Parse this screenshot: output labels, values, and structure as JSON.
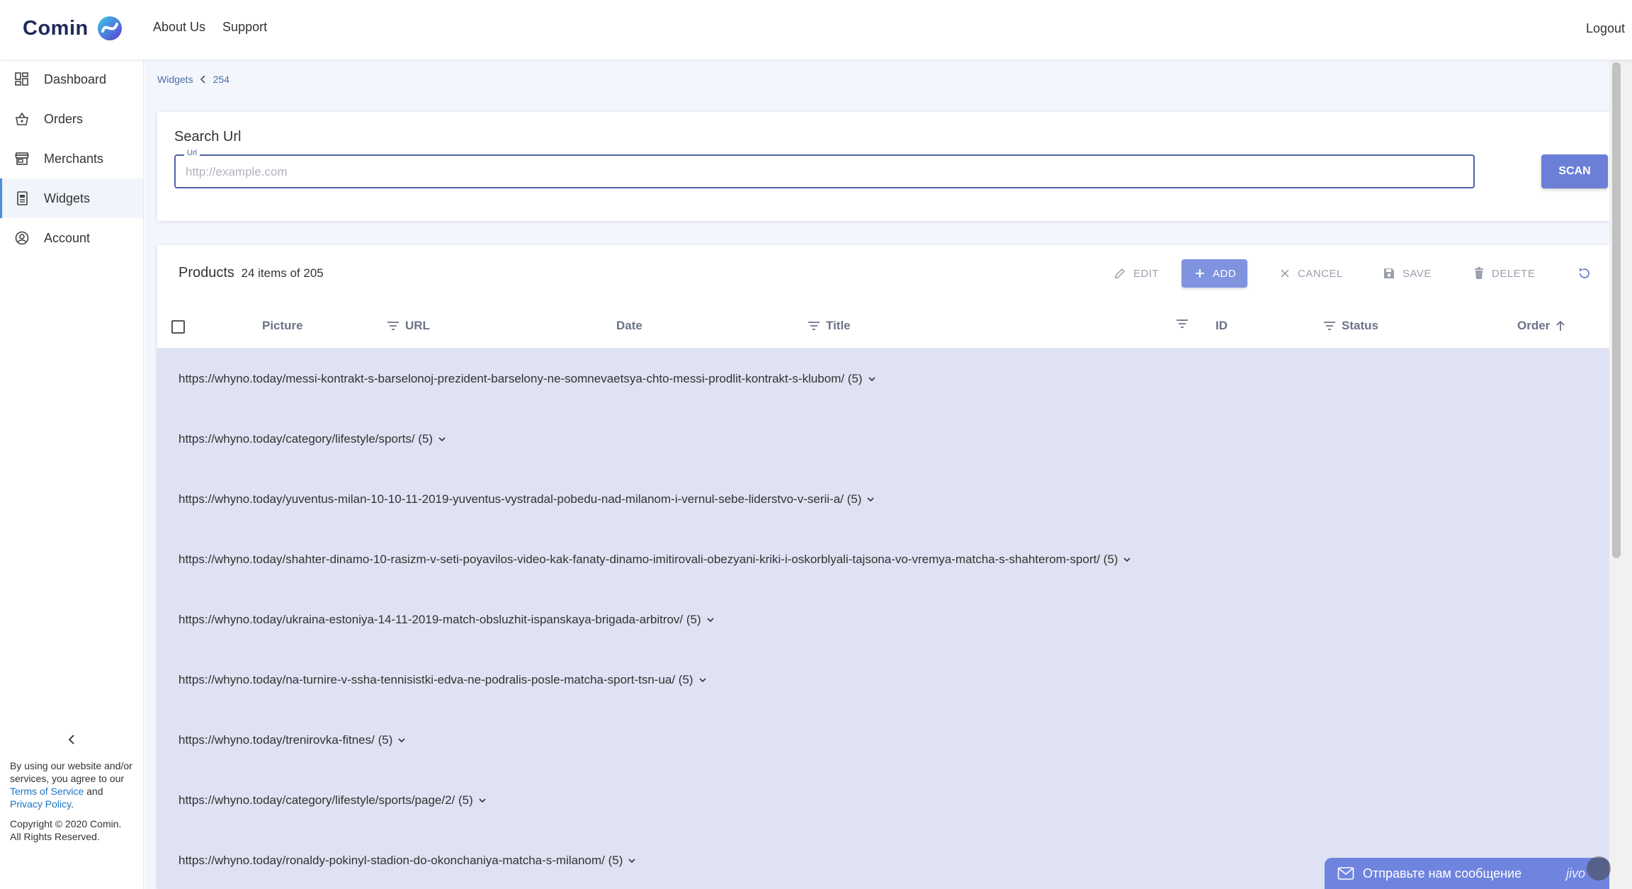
{
  "brand": {
    "name": "Comin"
  },
  "topnav": {
    "about": "About Us",
    "support": "Support",
    "logout": "Logout"
  },
  "sidebar": {
    "items": [
      {
        "label": "Dashboard",
        "icon": "dashboard-icon"
      },
      {
        "label": "Orders",
        "icon": "basket-icon"
      },
      {
        "label": "Merchants",
        "icon": "store-icon"
      },
      {
        "label": "Widgets",
        "icon": "widget-doc-icon",
        "active": true
      },
      {
        "label": "Account",
        "icon": "account-circle-icon"
      }
    ],
    "legal": {
      "intro": "By using our website and/or services, you agree to our ",
      "terms": "Terms of Service",
      "and": " and ",
      "privacy": "Privacy Policy",
      "period": ".",
      "copyright": "Copyright © 2020 Comin. All Rights Reserved."
    }
  },
  "breadcrumb": {
    "root": "Widgets",
    "current": "254"
  },
  "search": {
    "title": "Search Url",
    "field_label": "Url",
    "placeholder": "http://example.com",
    "value": "",
    "scan_label": "SCAN"
  },
  "products": {
    "title": "Products",
    "count_text": "24 items of 205",
    "toolbar": {
      "edit": "EDIT",
      "add": "ADD",
      "cancel": "CANCEL",
      "save": "SAVE",
      "delete": "DELETE"
    },
    "columns": {
      "picture": "Picture",
      "url": "URL",
      "date": "Date",
      "title": "Title",
      "id": "ID",
      "status": "Status",
      "order": "Order"
    },
    "groups": [
      "https://whyno.today/messi-kontrakt-s-barselonoj-prezident-barselony-ne-somnevaetsya-chto-messi-prodlit-kontrakt-s-klubom/ (5)",
      "https://whyno.today/category/lifestyle/sports/ (5)",
      "https://whyno.today/yuventus-milan-10-10-11-2019-yuventus-vystradal-pobedu-nad-milanom-i-vernul-sebe-liderstvo-v-serii-a/ (5)",
      "https://whyno.today/shahter-dinamo-10-rasizm-v-seti-poyavilos-video-kak-fanaty-dinamo-imitirovali-obezyani-kriki-i-oskorblyali-tajsona-vo-vremya-matcha-s-shahterom-sport/ (5)",
      "https://whyno.today/ukraina-estoniya-14-11-2019-match-obsluzhit-ispanskaya-brigada-arbitrov/ (5)",
      "https://whyno.today/na-turnire-v-ssha-tennisistki-edva-ne-podralis-posle-matcha-sport-tsn-ua/ (5)",
      "https://whyno.today/trenirovka-fitnes/ (5)",
      "https://whyno.today/category/lifestyle/sports/page/2/ (5)",
      "https://whyno.today/ronaldy-pokinyl-stadion-do-okonchaniya-matcha-s-milanom/ (5)"
    ]
  },
  "chat": {
    "label": "Отправьте нам сообщение",
    "brand": "jivo"
  },
  "colors": {
    "accent": "#6b7fd7",
    "rows_bg": "#dee2f2",
    "link": "#1b73c4"
  }
}
